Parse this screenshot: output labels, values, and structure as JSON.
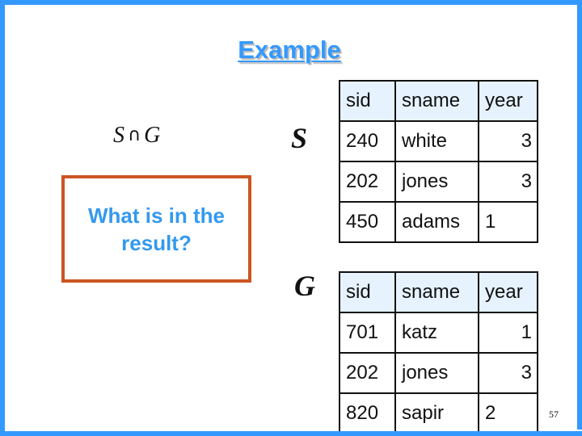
{
  "slide": {
    "title": "Example",
    "formula": {
      "left": "S",
      "operator": "∩",
      "right": "G"
    },
    "question": "What is in the result?",
    "page_number": "57",
    "colors": {
      "frame": "#3399ff",
      "title": "#3399ff",
      "question_text": "#3399ee",
      "question_border": "#cc5522",
      "table_header_bg": "#e6f2fd"
    }
  },
  "relations": [
    {
      "name": "S",
      "columns": [
        "sid",
        "sname",
        "year"
      ],
      "rows": [
        {
          "sid": "240",
          "sname": "white",
          "year": "3",
          "year_align": "right"
        },
        {
          "sid": "202",
          "sname": "jones",
          "year": "3",
          "year_align": "right"
        },
        {
          "sid": "450",
          "sname": "adams",
          "year": "1",
          "year_align": "left"
        }
      ]
    },
    {
      "name": "G",
      "columns": [
        "sid",
        "sname",
        "year"
      ],
      "rows": [
        {
          "sid": "701",
          "sname": "katz",
          "year": "1",
          "year_align": "right"
        },
        {
          "sid": "202",
          "sname": "jones",
          "year": "3",
          "year_align": "right"
        },
        {
          "sid": "820",
          "sname": "sapir",
          "year": "2",
          "year_align": "left"
        }
      ]
    }
  ]
}
